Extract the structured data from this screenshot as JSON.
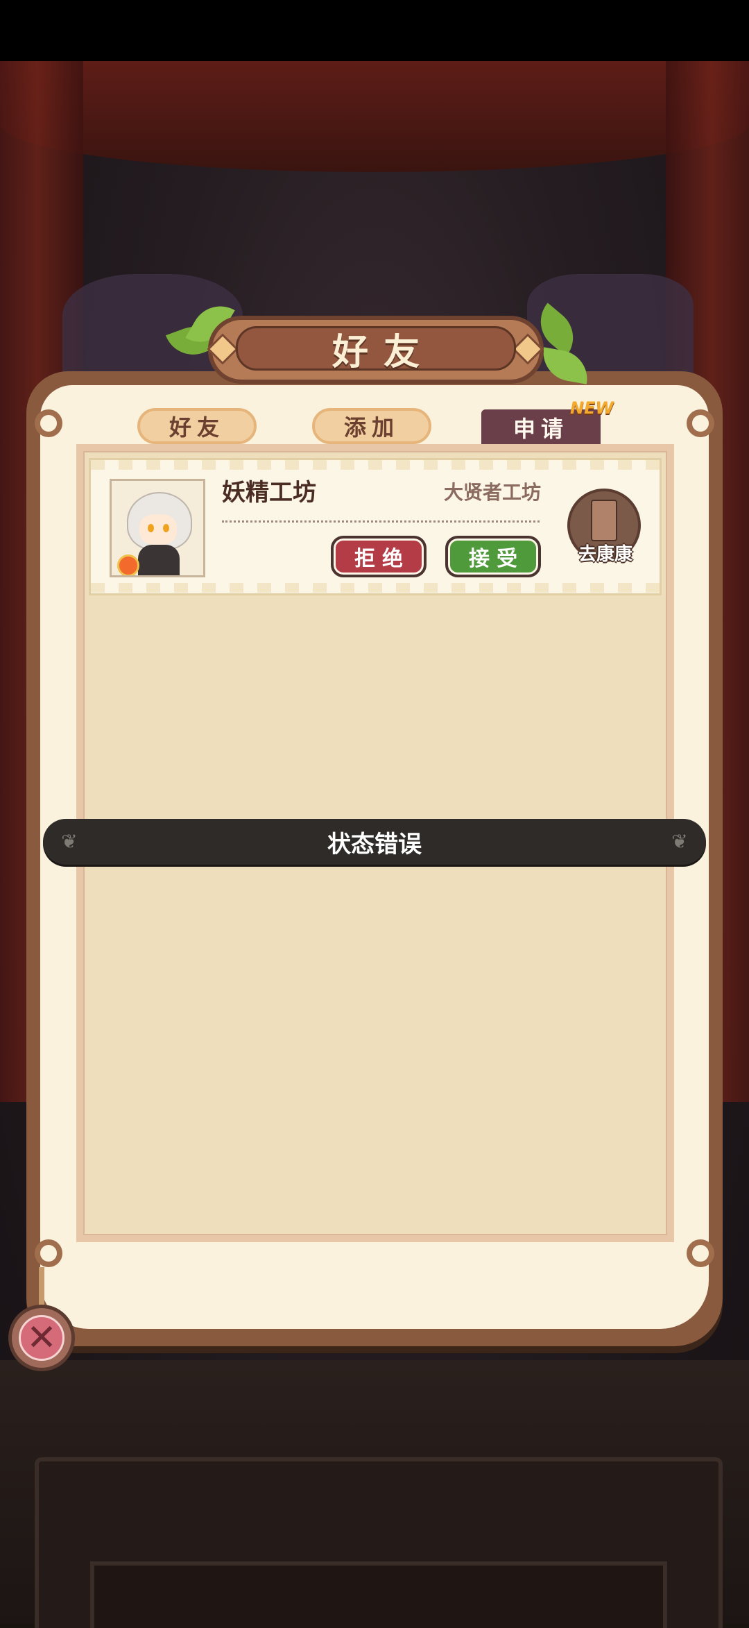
{
  "dialog": {
    "title": "好友"
  },
  "tabs": [
    {
      "label": "好友",
      "active": false
    },
    {
      "label": "添加",
      "active": false
    },
    {
      "label": "申请",
      "active": true
    }
  ],
  "new_badge": "NEW",
  "requests": [
    {
      "player_name": "妖精工坊",
      "workshop_name": "大贤者工坊",
      "reject_label": "拒绝",
      "accept_label": "接受",
      "visit_label": "去康康"
    }
  ],
  "toast": {
    "message": "状态错误"
  },
  "icons": {
    "close": "close-icon",
    "visit": "door-icon",
    "avatar": "fairy-avatar"
  },
  "colors": {
    "reject": "#b33c47",
    "accept": "#4f9a3a",
    "tab_active": "#6b3f49",
    "new_badge": "#f2a92c"
  }
}
